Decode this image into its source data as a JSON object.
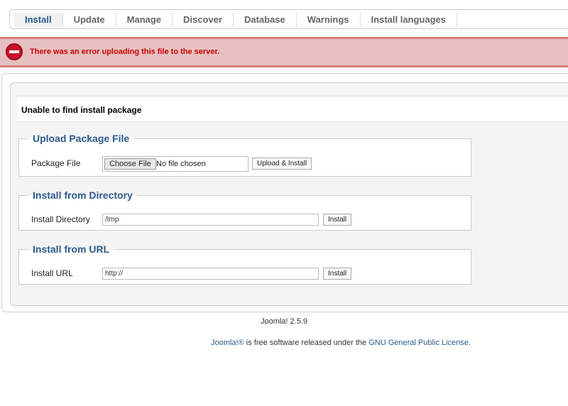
{
  "tabs": [
    {
      "label": "Install",
      "active": true
    },
    {
      "label": "Update"
    },
    {
      "label": "Manage"
    },
    {
      "label": "Discover"
    },
    {
      "label": "Database"
    },
    {
      "label": "Warnings"
    },
    {
      "label": "Install languages"
    }
  ],
  "error": {
    "message": "There was an error uploading this file to the server.",
    "icon": "error-icon",
    "color": "#cc0000"
  },
  "heading": "Unable to find install package",
  "upload": {
    "legend": "Upload Package File",
    "label": "Package File",
    "choose_label": "Choose File",
    "no_file_text": "No file chosen",
    "button_label": "Upload & Install"
  },
  "directory": {
    "legend": "Install from Directory",
    "label": "Install Directory",
    "value": "/tmp",
    "button_label": "Install"
  },
  "url": {
    "legend": "Install from URL",
    "label": "Install URL",
    "value": "http://",
    "button_label": "Install"
  },
  "footer": {
    "version": "Joomla! 2.5.9",
    "brand_link": "Joomla!®",
    "middle_text": " is free software released under the ",
    "license_link": "GNU General Public License",
    "end_text": "."
  },
  "colors": {
    "accent": "#2b5a8a",
    "error_bg": "#e6c0c0",
    "error_border": "#de7a7b"
  }
}
